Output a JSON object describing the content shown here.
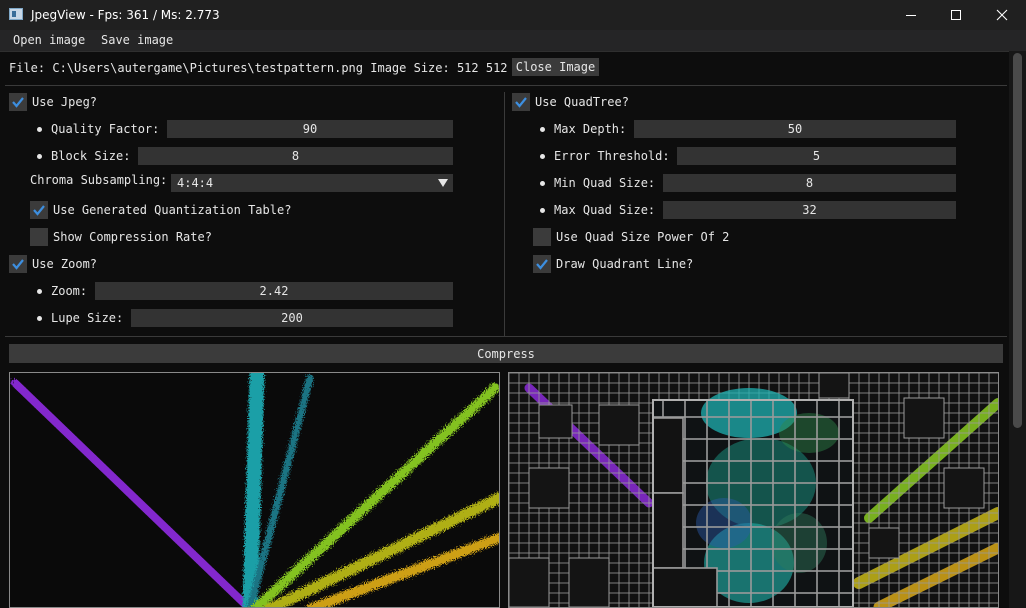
{
  "window": {
    "title": "JpegView - Fps: 361 / Ms: 2.773",
    "icon": "app-window-icon"
  },
  "menu": {
    "items": [
      "Open image",
      "Save image"
    ]
  },
  "file": {
    "label": "File: C:\\Users\\autergame\\Pictures\\testpattern.png",
    "size_label": "Image Size: 512 512",
    "close_button": "Close Image"
  },
  "jpeg": {
    "use_label": "Use Jpeg?",
    "use_checked": true,
    "quality_label": "Quality Factor:",
    "quality_value": "90",
    "block_label": "Block Size:",
    "block_value": "8",
    "chroma_label": "Chroma Subsampling:",
    "chroma_value": "4:4:4",
    "generated_label": "Use Generated Quantization Table?",
    "generated_checked": true,
    "compression_label": "Show Compression Rate?",
    "compression_checked": false
  },
  "zoom": {
    "use_label": "Use Zoom?",
    "use_checked": true,
    "zoom_label": "Zoom:",
    "zoom_value": "2.42",
    "lupe_label": "Lupe Size:",
    "lupe_value": "200"
  },
  "quadtree": {
    "use_label": "Use QuadTree?",
    "use_checked": true,
    "max_depth_label": "Max Depth:",
    "max_depth_value": "50",
    "error_label": "Error Threshold:",
    "error_value": "5",
    "min_quad_label": "Min Quad Size:",
    "min_quad_value": "8",
    "max_quad_label": "Max Quad Size:",
    "max_quad_value": "32",
    "power_label": "Use Quad Size Power Of 2",
    "power_checked": false,
    "draw_label": "Draw Quadrant Line?",
    "draw_checked": true
  },
  "compress_button": "Compress",
  "colors": {
    "accent": "#3d8fe0",
    "frame": "#3b3b3b",
    "background": "#0d0d0d"
  }
}
